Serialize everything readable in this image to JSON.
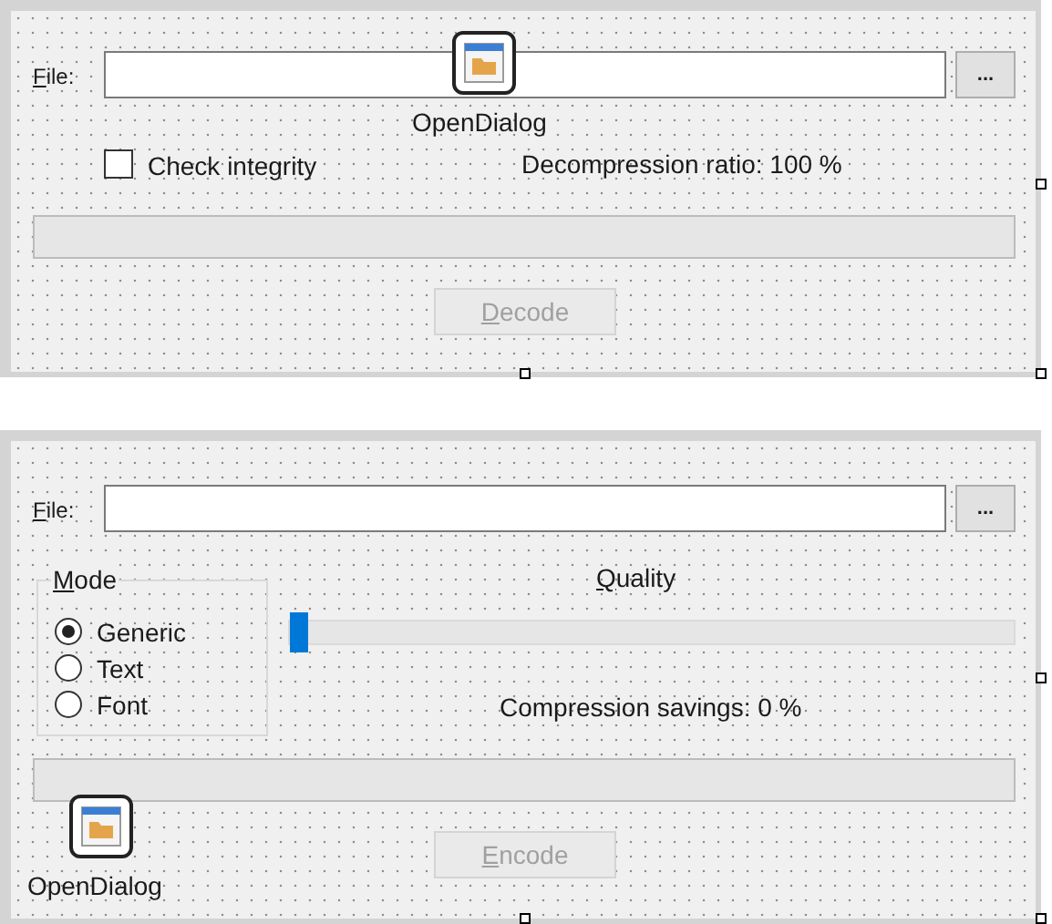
{
  "forms": [
    {
      "kind": "decoder",
      "file_label": {
        "text": "File:",
        "underline_first": true
      },
      "browse_button": "...",
      "dialog_component": {
        "label": "OpenDialog"
      },
      "check": {
        "label": "Check integrity",
        "checked": false
      },
      "ratio_label": "Decompression ratio: 100 %",
      "progress": {
        "level": 0
      },
      "action_button": {
        "label": "Decode",
        "underline_first": true,
        "disabled": true
      }
    },
    {
      "kind": "encoder",
      "file_label": {
        "text": "File:",
        "underline_first": true
      },
      "browse_button": "...",
      "mode_group": {
        "title": "Mode",
        "underline_first": true,
        "options": [
          {
            "label": "Generic",
            "selected": true
          },
          {
            "label": "Text",
            "selected": false
          },
          {
            "label": "Font",
            "selected": false
          }
        ]
      },
      "quality_label": {
        "text": "Quality",
        "underline_first": true
      },
      "slider": {
        "level": 0
      },
      "savings_label": "Compression savings: 0 %",
      "progress": {
        "level": 0
      },
      "dialog_component": {
        "label": "OpenDialog"
      },
      "action_button": {
        "label": "Encode",
        "underline_first": true,
        "disabled": true
      }
    }
  ]
}
